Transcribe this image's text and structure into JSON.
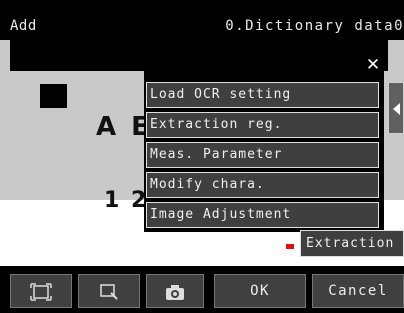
{
  "header": {
    "mode_label": "Add",
    "dictionary_label": "0.Dictionary data0"
  },
  "preview": {
    "sample_text_top": "A E",
    "sample_text_bottom": "1 2"
  },
  "menu": {
    "items": [
      {
        "label": "Load OCR setting"
      },
      {
        "label": "Extraction reg."
      },
      {
        "label": "Meas. Parameter"
      },
      {
        "label": "Modify chara."
      },
      {
        "label": "Image Adjustment"
      }
    ],
    "close_icon": "close-icon"
  },
  "extraction_button": {
    "label": "Extraction"
  },
  "toolbar": {
    "fit_icon": "fit-screen-icon",
    "zoom_icon": "zoom-icon",
    "camera_icon": "camera-icon",
    "ok_label": "OK",
    "cancel_label": "Cancel"
  },
  "colors": {
    "menu_bg": "#3f3f3f",
    "panel_gray": "#c9c9c9",
    "marker_red": "#e01010"
  }
}
